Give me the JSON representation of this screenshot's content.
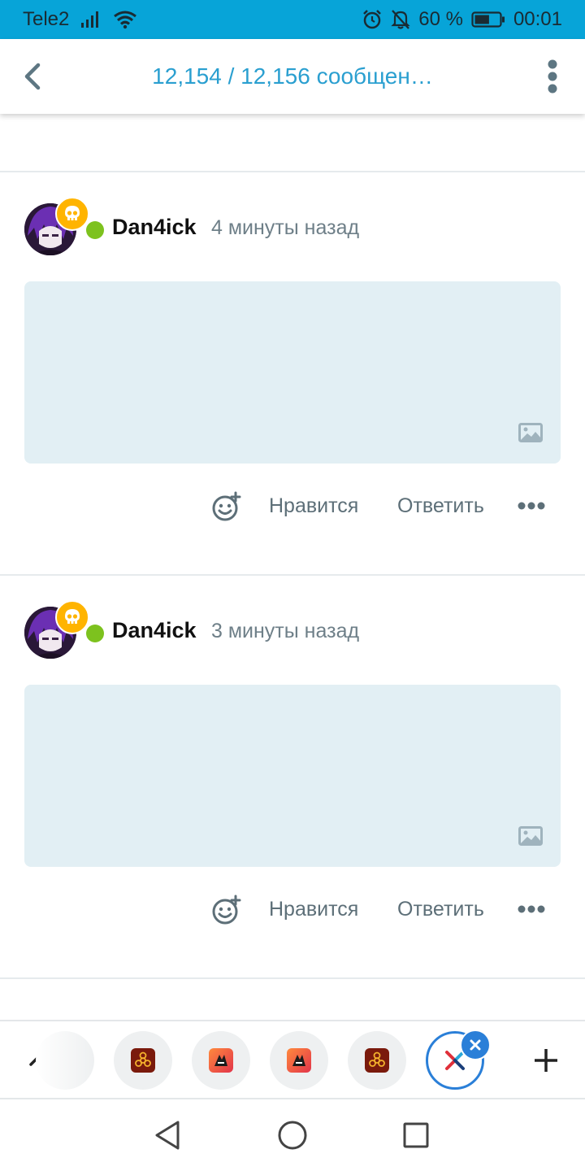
{
  "status_bar": {
    "carrier": "Tele2",
    "battery_percent": "60 %",
    "battery_level": 0.6,
    "time": "00:01",
    "icons": [
      "signal-icon",
      "wifi-icon",
      "alarm-icon",
      "bell-off-icon",
      "battery-icon"
    ]
  },
  "header": {
    "title": "12,154 / 12,156 сообщен…",
    "icons": [
      "back-arrow-icon",
      "more-vertical-icon"
    ]
  },
  "posts": [
    {
      "username": "Dan4ick",
      "timestamp": "4 минуты назад",
      "online": true,
      "badge_icon": "skull-icon",
      "like_label": "Нравится",
      "reply_label": "Ответить"
    },
    {
      "username": "Dan4ick",
      "timestamp": "3 минуты назад",
      "online": true,
      "badge_icon": "skull-icon",
      "like_label": "Нравится",
      "reply_label": "Ответить"
    }
  ],
  "tab_bar": {
    "tabs": [
      {
        "icon": "biohazard-app-icon"
      },
      {
        "icon": "anime-app-icon"
      },
      {
        "icon": "anime-app-icon"
      },
      {
        "icon": "biohazard-app-icon"
      },
      {
        "icon": "x-app-icon",
        "active": true
      }
    ]
  },
  "colors": {
    "status_bar": "#07a4d8",
    "accent": "#2a9fd0",
    "online": "#7dc21e",
    "badge": "#ffb400",
    "image_placeholder": "#e2eff4",
    "active_tab": "#2a7fd8"
  }
}
